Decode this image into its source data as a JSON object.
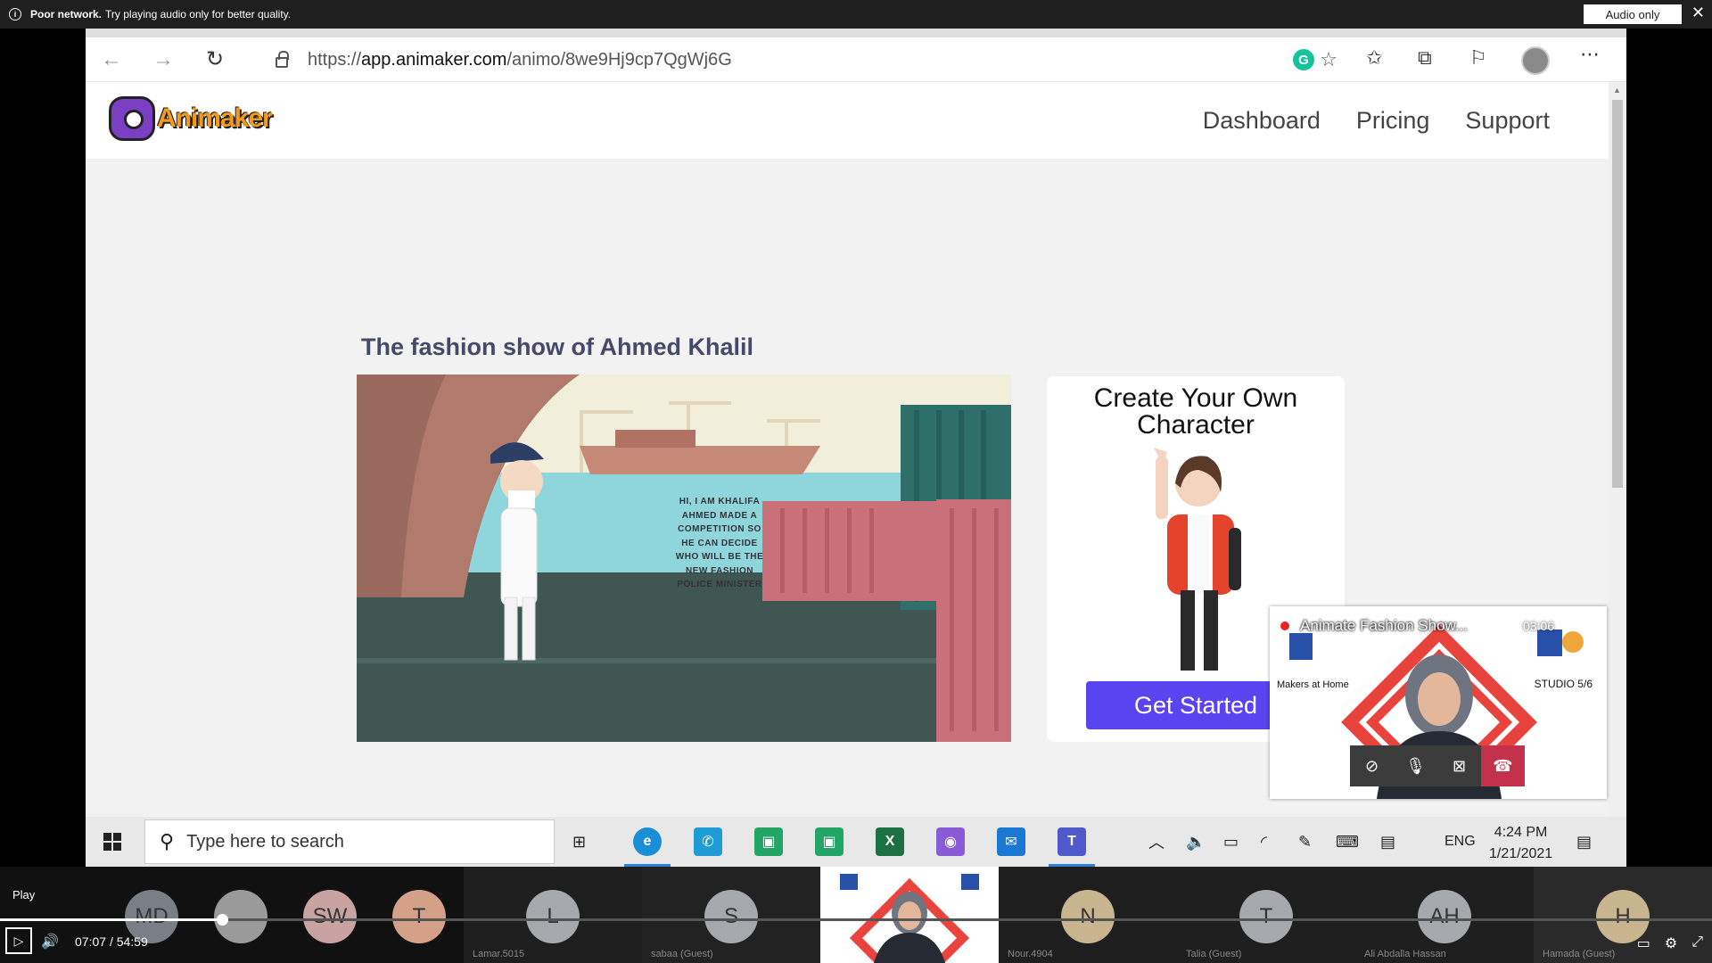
{
  "notice": {
    "bold": "Poor network.",
    "text": "Try playing audio only for better quality.",
    "audio_only_label": "Audio only",
    "close_glyph": "✕"
  },
  "browser": {
    "url_scheme": "https://",
    "url_host": "app.animaker.com",
    "url_path": "/animo/8we9Hj9cp7QgWj6G"
  },
  "site": {
    "logo_text": "Animaker",
    "nav": [
      "Dashboard",
      "Pricing",
      "Support"
    ]
  },
  "project": {
    "title": "The fashion show of Ahmed Khalil",
    "speech": "HI, I AM KHALIFA AHMED MADE A COMPETITION SO HE CAN DECIDE WHO WILL BE THE NEW FASHION POLICE MINISTER"
  },
  "cta": {
    "title": "Create Your Own Character",
    "button": "Get Started"
  },
  "pip": {
    "title": "Animate Fashion Show...",
    "timer": "03:06",
    "makers_label": "Makers at Home",
    "studio_label": "STUDIO 5/6"
  },
  "taskbar": {
    "search_placeholder": "Type here to search",
    "language": "ENG",
    "time": "4:24 PM",
    "date": "1/21/2021"
  },
  "call": {
    "play_label": "Play",
    "current_time": "07:07",
    "separator": "/",
    "total_time": "54:59",
    "progress_fraction": 0.13,
    "participants": [
      {
        "initials": "MD",
        "name": ""
      },
      {
        "initials": "",
        "name": ""
      },
      {
        "initials": "SW",
        "name": ""
      },
      {
        "initials": "T",
        "name": ""
      },
      {
        "initials": "L",
        "name": "Lamar.5015"
      },
      {
        "initials": "S",
        "name": "sabaa (Guest)"
      },
      {
        "initials": "N",
        "name": "Nour.4904"
      },
      {
        "initials": "T",
        "name": "Talia (Guest)"
      },
      {
        "initials": "AH",
        "name": "Ali Abdalla Hassan"
      },
      {
        "initials": "H",
        "name": "Hamada (Guest)"
      }
    ]
  },
  "colors": {
    "accent": "#5a44f0",
    "end_call": "#c4314b",
    "title_text": "#454a68"
  }
}
